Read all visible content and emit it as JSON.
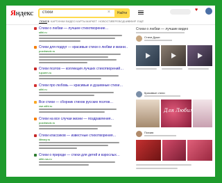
{
  "header": {
    "logo_y": "Я",
    "logo_rest": "ндекс",
    "search_value": "стихи",
    "search_clear": "×",
    "search_button": "Найти"
  },
  "tabs": [
    "ПОИСК",
    "КАРТИНКИ",
    "ВИДЕО",
    "КАРТЫ",
    "МАРКЕТ",
    "НОВОСТИ",
    "ПЕРЕВОДЧИК",
    "ЭФИР",
    "ЕЩЁ"
  ],
  "results": [
    {
      "title": "Стихи о любви — лучшее стихотворение…",
      "url": "stihi.ru",
      "color": "#d32f2f"
    },
    {
      "title": "Стихи для подруг — красивые стихи о любви и жизни…",
      "url": "pozdravok.ru",
      "color": "#f57c00"
    },
    {
      "title": "Стихи поэтов — коллекция лучших стихотворений…",
      "url": "rupoem.ru",
      "color": "#c62828"
    },
    {
      "title": "Стихи про любовь — красивые и душевные стихи…",
      "url": "stihi.ru",
      "color": "#d32f2f"
    },
    {
      "title": "Все стихи — сборник стихов русских поэтов…",
      "url": "vse-stihi.ru",
      "color": "#f9a825"
    },
    {
      "title": "Стихи на все случаи жизни — поздравления…",
      "url": "pozdravok.ru",
      "color": "#f57c00"
    },
    {
      "title": "Стихи классиков — известные стихотворения…",
      "url": "ilibrary.ru",
      "color": "#c62828"
    },
    {
      "title": "Стихи о природе — стихи для детей и взрослых…",
      "url": "stihi-rus.ru",
      "color": "#2e7d32"
    }
  ],
  "right": {
    "title": "Стихи о любви — лучшие видео",
    "heart_text": "Для Любимой",
    "channels": [
      "Стихи Души",
      "Красивые стихи",
      "Поэзия"
    ]
  },
  "colors": {
    "border": "#1e9b2d",
    "accent": "#ffdb4d",
    "link": "#1a0dab",
    "url": "#007700"
  }
}
